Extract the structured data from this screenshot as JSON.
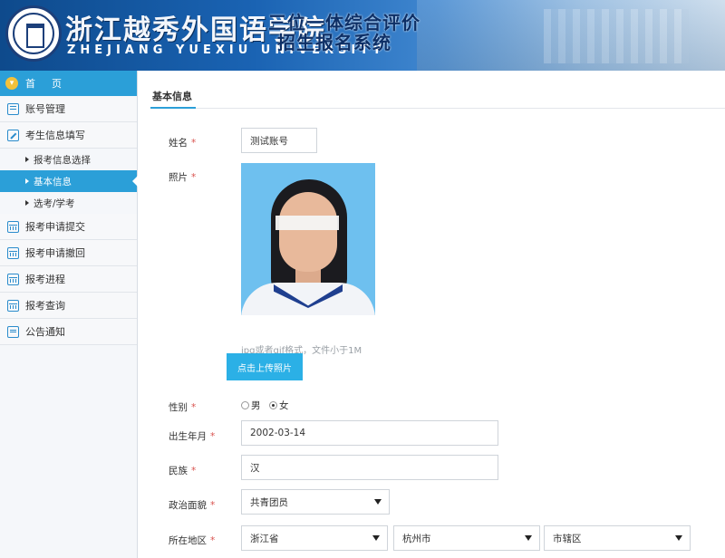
{
  "header": {
    "school_cn": "浙江越秀外国语学院",
    "school_en": "ZHEJIANG YUEXIU UNIVERSITY",
    "system_title_line1": "三位一体综合评价",
    "system_title_line2": "招生报名系统"
  },
  "sidebar": {
    "home": "首页",
    "items": [
      {
        "label": "账号管理",
        "icon": "list-icon"
      },
      {
        "label": "考生信息填写",
        "icon": "edit-icon"
      }
    ],
    "sub_items": [
      {
        "label": "报考信息选择"
      },
      {
        "label": "基本信息"
      },
      {
        "label": "选考/学考"
      }
    ],
    "items2": [
      {
        "label": "报考申请提交",
        "icon": "calendar-icon"
      },
      {
        "label": "报考申请撤回",
        "icon": "calendar-icon"
      },
      {
        "label": "报考进程",
        "icon": "calendar-icon"
      },
      {
        "label": "报考查询",
        "icon": "calendar-icon"
      },
      {
        "label": "公告通知",
        "icon": "message-icon"
      }
    ]
  },
  "main": {
    "tab": "基本信息",
    "name_label": "姓名",
    "name_value": "测试账号",
    "photo_label": "照片",
    "photo_hint": "jpg或者gif格式，文件小于1M",
    "upload_btn": "点击上传照片",
    "gender_label": "性别",
    "gender_male": "男",
    "gender_female": "女",
    "birth_label": "出生年月",
    "birth_value": "2002-03-14",
    "ethnic_label": "民族",
    "ethnic_value": "汉",
    "political_label": "政治面貌",
    "political_value": "共青团员",
    "region_label": "所在地区",
    "province": "浙江省",
    "city": "杭州市",
    "district": "市辖区"
  },
  "colors": {
    "accent": "#2b9fd8",
    "required": "#d9534f"
  }
}
